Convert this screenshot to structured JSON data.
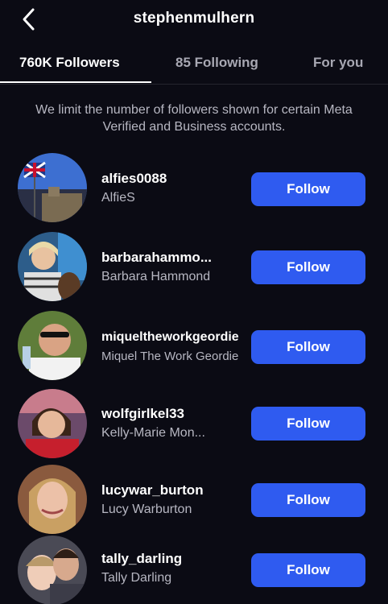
{
  "header": {
    "title": "stephenmulhern",
    "back_icon": "chevron-left-icon"
  },
  "tabs": [
    {
      "label": "760K Followers",
      "active": true
    },
    {
      "label": "85 Following",
      "active": false
    },
    {
      "label": "For you",
      "active": false
    }
  ],
  "notice": "We limit the number of followers shown for certain Meta Verified and Business accounts.",
  "followers": [
    {
      "username": "alfies0088",
      "name": "AlfieS",
      "button": "Follow"
    },
    {
      "username": "barbarahammo...",
      "name": "Barbara Hammond",
      "button": "Follow"
    },
    {
      "username": "miqueltheworkgeordie",
      "name": "Miquel The Work Geordie",
      "button": "Follow"
    },
    {
      "username": "wolfgirlkel33",
      "name": "Kelly-Marie Mon...",
      "button": "Follow"
    },
    {
      "username": "lucywar_burton",
      "name": "Lucy Warburton",
      "button": "Follow"
    },
    {
      "username": "tally_darling",
      "name": "Tally Darling",
      "button": "Follow"
    }
  ],
  "colors": {
    "background": "#0b0b14",
    "accent": "#2f5bf0",
    "secondary_text": "#b7b7c2"
  }
}
